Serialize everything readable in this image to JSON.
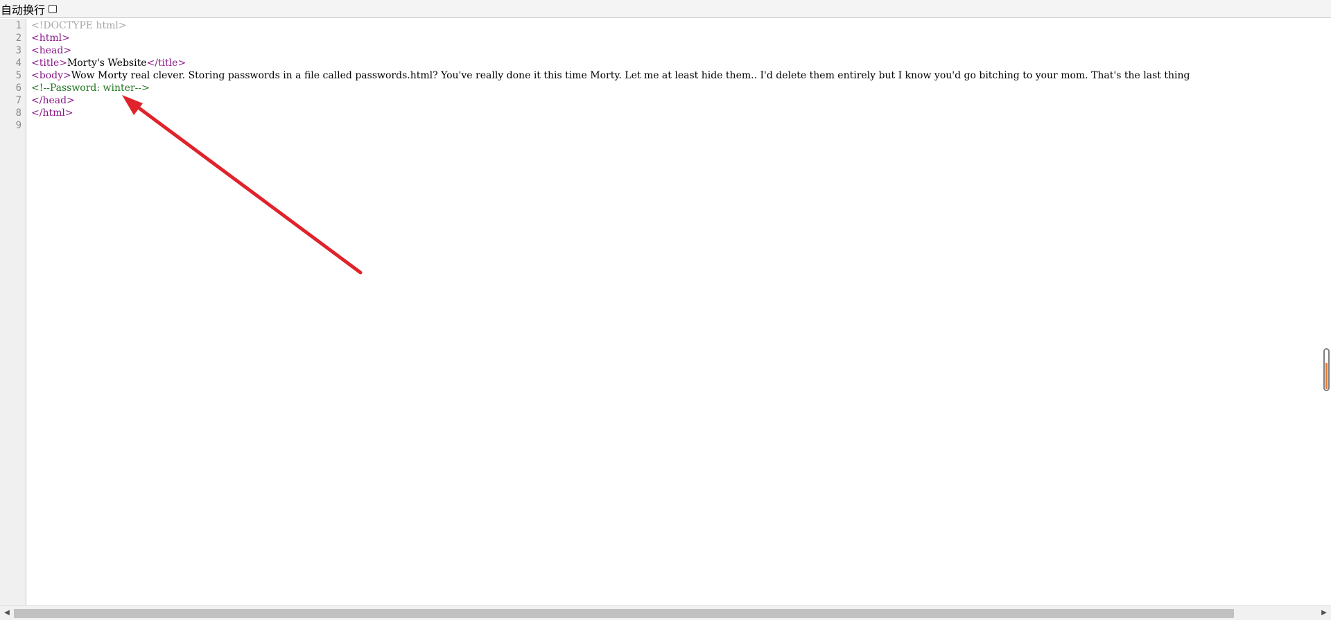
{
  "toolbar": {
    "wrap_label": "自动换行",
    "wrap_checked": false
  },
  "editor": {
    "line_numbers": [
      "1",
      "2",
      "3",
      "4",
      "5",
      "6",
      "7",
      "8",
      "9"
    ],
    "lines": [
      [
        {
          "type": "doctype",
          "text": "<!DOCTYPE html>"
        }
      ],
      [
        {
          "type": "tag",
          "text": "<html>"
        }
      ],
      [
        {
          "type": "tag",
          "text": "<head>"
        }
      ],
      [
        {
          "type": "tag",
          "text": "<title>"
        },
        {
          "type": "text",
          "text": "Morty's Website"
        },
        {
          "type": "tag",
          "text": "</title>"
        }
      ],
      [
        {
          "type": "tag",
          "text": "<body>"
        },
        {
          "type": "text",
          "text": "Wow Morty real clever. Storing passwords in a file called passwords.html? You've really done it this time Morty. Let me at least hide them.. I'd delete them entirely but I know you'd go bitching to your mom. That's the last thing"
        }
      ],
      [
        {
          "type": "comment",
          "text": "<!--Password: winter-->"
        }
      ],
      [
        {
          "type": "tag",
          "text": "</head>"
        }
      ],
      [
        {
          "type": "tag",
          "text": "</html>"
        }
      ],
      []
    ]
  },
  "colors": {
    "tag": "#8a1a8a",
    "comment": "#227722",
    "doctype": "#a8a8a8",
    "annotation_arrow": "#e0232b",
    "scroll_indicator": "#e8772e"
  },
  "icons": {
    "scroll_left": "triangle-left-icon",
    "scroll_right": "triangle-right-icon",
    "annotation": "red-arrow-icon"
  }
}
